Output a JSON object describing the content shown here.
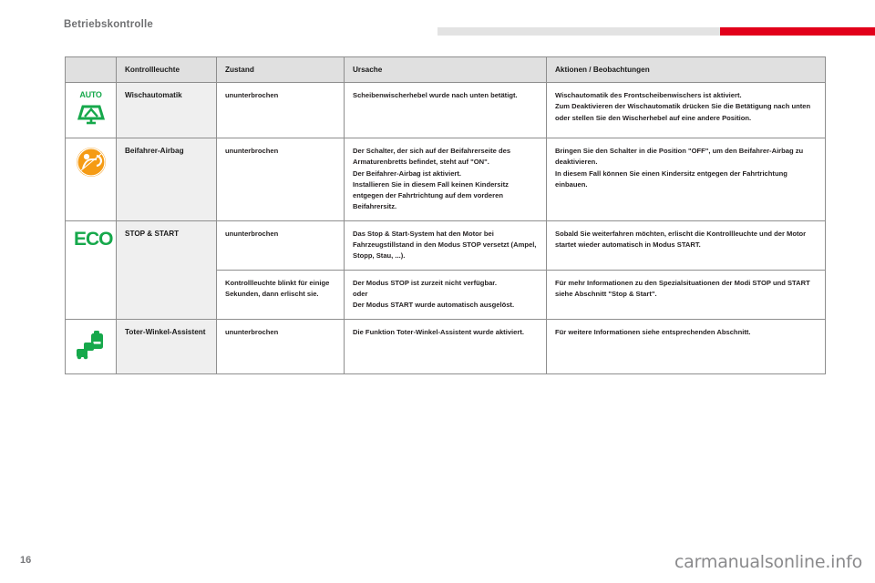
{
  "header": {
    "title": "Betriebskontrolle",
    "rule_grey": "#e3e3e3",
    "rule_red": "#e2001a"
  },
  "table": {
    "columns": [
      {
        "key": "icon",
        "label": ""
      },
      {
        "key": "lamp",
        "label": "Kontrollleuchte"
      },
      {
        "key": "state",
        "label": "Zustand"
      },
      {
        "key": "cause",
        "label": "Ursache"
      },
      {
        "key": "action",
        "label": "Aktionen / Beobachtungen"
      }
    ],
    "rows": [
      {
        "icon": "auto-wiper-icon",
        "icon_color": "#16a84b",
        "icon_label": "AUTO",
        "lamp": "Wischautomatik",
        "state": "ununterbrochen",
        "cause": [
          "Scheibenwischerhebel wurde nach unten betätigt."
        ],
        "action": [
          "Wischautomatik des Frontscheibenwischers ist aktiviert.",
          "Zum Deaktivieren der Wischautomatik drücken Sie die Betätigung nach unten oder stellen Sie den Wischerhebel auf eine andere Position."
        ]
      },
      {
        "icon": "passenger-airbag-icon",
        "icon_color": "#f59b14",
        "icon_label": "",
        "lamp": "Beifahrer-Airbag",
        "state": "ununterbrochen",
        "cause": [
          "Der Schalter, der sich auf der Beifahrerseite des Armaturenbretts befindet, steht auf \"ON\".",
          "Der Beifahrer-Airbag ist aktiviert.",
          "Installieren Sie in diesem Fall keinen Kindersitz entgegen der Fahrtrichtung auf dem vorderen Beifahrersitz."
        ],
        "action": [
          "Bringen Sie den Schalter in die Position \"OFF\", um den Beifahrer-Airbag zu deaktivieren.",
          "In diesem Fall können Sie einen Kindersitz entgegen der Fahrtrichtung einbauen."
        ]
      },
      {
        "icon": "eco-icon",
        "icon_color": "#16a84b",
        "icon_label": "ECO",
        "lamp": "STOP & START",
        "state": "ununterbrochen",
        "cause": [
          "Das Stop & Start-System hat den Motor bei Fahrzeugstillstand in den Modus STOP versetzt (Ampel, Stopp, Stau, ...)."
        ],
        "action": [
          "Sobald Sie weiterfahren möchten, erlischt die Kontrollleuchte und der Motor startet wieder automatisch in Modus START."
        ]
      },
      {
        "icon": "",
        "icon_color": "",
        "icon_label": "",
        "lamp": "",
        "state": "Kontrollleuchte blinkt für einige Sekunden, dann erlischt sie.",
        "cause": [
          "Der Modus STOP ist zurzeit nicht verfügbar.",
          "oder",
          "Der Modus START wurde automatisch ausgelöst."
        ],
        "action": [
          "Für mehr Informationen zu den Spezialsituationen der Modi STOP und START siehe Abschnitt \"Stop & Start\"."
        ]
      },
      {
        "icon": "blind-spot-icon",
        "icon_color": "#16a84b",
        "icon_label": "",
        "lamp": "Toter-Winkel-Assistent",
        "state": "ununterbrochen",
        "cause": [
          "Die Funktion Toter-Winkel-Assistent wurde aktiviert."
        ],
        "action": [
          "Für weitere Informationen siehe entsprechenden Abschnitt."
        ]
      }
    ]
  },
  "footer": {
    "page_number": "16",
    "watermark": "carmanualsonline.info"
  }
}
